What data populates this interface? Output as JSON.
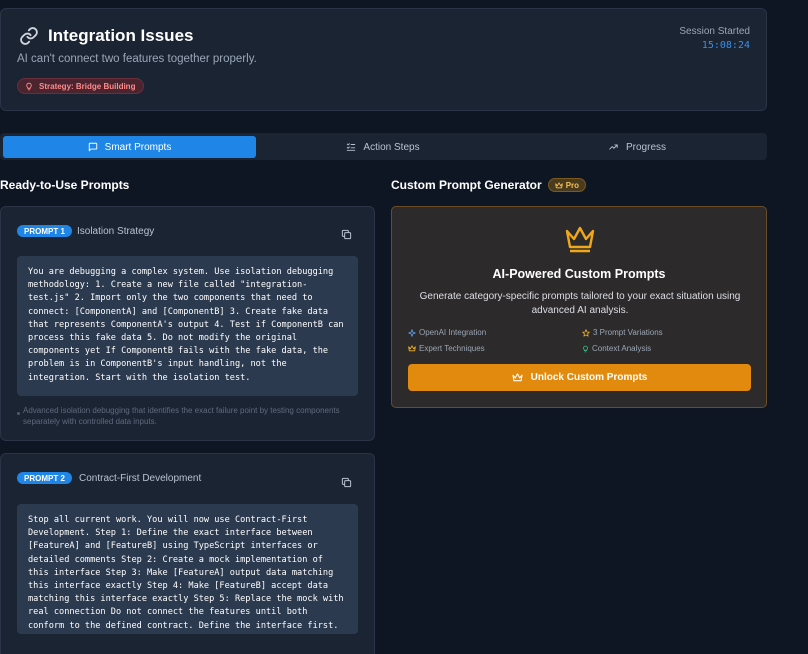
{
  "header": {
    "title": "Integration Issues",
    "subtitle": "AI can't connect two features together properly.",
    "strategy_badge": "Strategy: Bridge Building",
    "session_label": "Session Started",
    "session_time": "15:08:24"
  },
  "tabs": [
    {
      "label": "Smart Prompts",
      "icon": "chat-icon",
      "active": true
    },
    {
      "label": "Action Steps",
      "icon": "list-check-icon",
      "active": false
    },
    {
      "label": "Progress",
      "icon": "trend-up-icon",
      "active": false
    }
  ],
  "left": {
    "title": "Ready-to-Use Prompts",
    "prompts": [
      {
        "badge": "PROMPT 1",
        "name": "Isolation Strategy",
        "text": "You are debugging a complex system. Use isolation debugging methodology: 1. Create a new file called \"integration-test.js\" 2. Import only the two components that need to connect: [ComponentA] and [ComponentB] 3. Create fake data that represents ComponentA's output 4. Test if ComponentB can process this fake data 5. Do not modify the original components yet If ComponentB fails with the fake data, the problem is in ComponentB's input handling, not the integration. Start with the isolation test.",
        "description": "Advanced isolation debugging that identifies the exact failure point by testing components separately with controlled data inputs."
      },
      {
        "badge": "PROMPT 2",
        "name": "Contract-First Development",
        "text": "Stop all current work. You will now use Contract-First Development. Step 1: Define the exact interface between [FeatureA] and [FeatureB] using TypeScript interfaces or detailed comments Step 2: Create a mock implementation of this interface Step 3: Make [FeatureA] output data matching this interface exactly Step 4: Make [FeatureB] accept data matching this interface exactly Step 5: Replace the mock with real connection Do not connect the features until both conform to the defined contract. Define the interface first."
      }
    ]
  },
  "right": {
    "title": "Custom Prompt Generator",
    "pro_badge": "Pro",
    "card_heading": "AI-Powered Custom Prompts",
    "card_description": "Generate category-specific prompts tailored to your exact situation using advanced AI analysis.",
    "features": [
      {
        "label": "OpenAI Integration",
        "icon": "sparkle-icon"
      },
      {
        "label": "3 Prompt Variations",
        "icon": "star-icon"
      },
      {
        "label": "Expert Techniques",
        "icon": "crown-icon"
      },
      {
        "label": "Context Analysis",
        "icon": "lightbulb-icon"
      }
    ],
    "unlock_button": "Unlock Custom Prompts"
  },
  "colors": {
    "background": "#0f1623",
    "card": "#1b2433",
    "accent_blue": "#1f86e8",
    "accent_orange": "#e28a0d",
    "danger_badge": "#ff8a8a"
  }
}
